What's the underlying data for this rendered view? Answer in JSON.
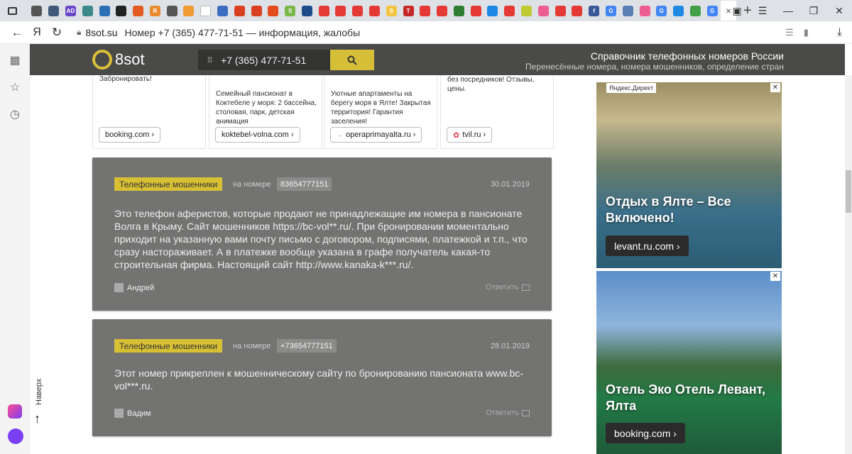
{
  "browser": {
    "tab_icons": [
      {
        "color": "#555555",
        "glyph": ""
      },
      {
        "color": "#43597a",
        "glyph": ""
      },
      {
        "color": "#6a47c9",
        "glyph": "AD"
      },
      {
        "color": "#3b8a8a",
        "glyph": ""
      },
      {
        "color": "#2d6fb5",
        "glyph": ""
      },
      {
        "color": "#222222",
        "glyph": ""
      },
      {
        "color": "#e25b22",
        "glyph": ""
      },
      {
        "color": "#e88a2e",
        "glyph": "R"
      },
      {
        "color": "#555555",
        "glyph": ""
      },
      {
        "color": "#f09a32",
        "glyph": ""
      },
      {
        "color": "#ffffff",
        "glyph": ""
      },
      {
        "color": "#3b6ec2",
        "glyph": ""
      },
      {
        "color": "#d8401f",
        "glyph": ""
      },
      {
        "color": "#d8401f",
        "glyph": ""
      },
      {
        "color": "#e44c1d",
        "glyph": ""
      },
      {
        "color": "#7ab648",
        "glyph": "S"
      },
      {
        "color": "#1c4d8a",
        "glyph": ""
      },
      {
        "color": "#e53935",
        "glyph": ""
      },
      {
        "color": "#e53935",
        "glyph": ""
      },
      {
        "color": "#e53935",
        "glyph": ""
      },
      {
        "color": "#e53935",
        "glyph": ""
      },
      {
        "color": "#f4c542",
        "glyph": "S"
      },
      {
        "color": "#c62828",
        "glyph": "T"
      },
      {
        "color": "#e53935",
        "glyph": ""
      },
      {
        "color": "#e53935",
        "glyph": ""
      },
      {
        "color": "#2e7d32",
        "glyph": ""
      },
      {
        "color": "#e53935",
        "glyph": ""
      },
      {
        "color": "#1e88e5",
        "glyph": ""
      },
      {
        "color": "#e53935",
        "glyph": ""
      },
      {
        "color": "#c0ca33",
        "glyph": ""
      },
      {
        "color": "#ec5e90",
        "glyph": ""
      },
      {
        "color": "#e53935",
        "glyph": ""
      },
      {
        "color": "#e53935",
        "glyph": ""
      },
      {
        "color": "#3b5998",
        "glyph": "f"
      },
      {
        "color": "#4285f4",
        "glyph": "G"
      },
      {
        "color": "#5a7fb5",
        "glyph": ""
      },
      {
        "color": "#ec5e90",
        "glyph": ""
      },
      {
        "color": "#4285f4",
        "glyph": "G"
      },
      {
        "color": "#1e88e5",
        "glyph": ""
      },
      {
        "color": "#43a047",
        "glyph": ""
      },
      {
        "color": "#4285f4",
        "glyph": "G"
      }
    ],
    "active_tab_close": "×",
    "new_tab": "+",
    "url_domain": "8sot.su",
    "page_title": "Номер +7 (365) 477-71-51 — информация, жалобы",
    "yandex_glyph": "Я"
  },
  "site": {
    "logo_text": "8sot",
    "search_value": "+7 (365) 477-71-51",
    "header_title": "Справочник телефонных номеров России",
    "header_subtitle": "Перенесённые номера, номера мошенников, определение стран"
  },
  "ads": [
    {
      "top_text": "Забронировать!",
      "text": "",
      "button": "booking.com",
      "icon": ""
    },
    {
      "top_text": "",
      "text": "Семейный пансионат в Коктебеле у моря: 2 бассейна, столовая, парк, детская анимация",
      "button": "koktebel-volna.com",
      "icon": ""
    },
    {
      "top_text": "",
      "text": "Уютные апартаменты на берегу моря в Ялте! Закрытая территория! Гарантия заселения!",
      "button": "operaprimayalta.ru",
      "icon": "→"
    },
    {
      "top_text": "без посредников! Отзывы, цены.",
      "text": "",
      "button": "tvil.ru",
      "icon": "✿"
    }
  ],
  "comments": [
    {
      "tag": "Телефонные мошенники",
      "on_number": "на номере",
      "number": "83654777151",
      "date": "30.01.2019",
      "text": "Это телефон аферистов, которые продают не принадлежащие им номера в пансионате Волга в Крыму. Сайт мошенников https://bc-vol**.ru/. При бронировании моментально приходит на указанную вами почту письмо с договором, подписями, платежкой и т.п., что сразу настораживает. А в платежке вообще указана в графе получатель какая-то строительная фирма. Настоящий сайт http://www.kanaka-k***.ru/.",
      "author": "Андрей",
      "reply": "Ответить"
    },
    {
      "tag": "Телефонные мошенники",
      "on_number": "на номере",
      "number": "+73654777151",
      "date": "28.01.2019",
      "text": "Этот номер прикреплен к мошенническому сайту по бронированию пансионата www.bc-vol***.ru.",
      "author": "Вадим",
      "reply": "Ответить"
    }
  ],
  "to_top": "Наверх",
  "right_ads": [
    {
      "label": "Яндекс.Директ",
      "title": "Отдых в Ялте – Все Включено!",
      "button": "levant.ru.com ›"
    },
    {
      "label": "",
      "title": "Отель Эко Отель Левант, Ялта",
      "button": "booking.com ›"
    }
  ]
}
